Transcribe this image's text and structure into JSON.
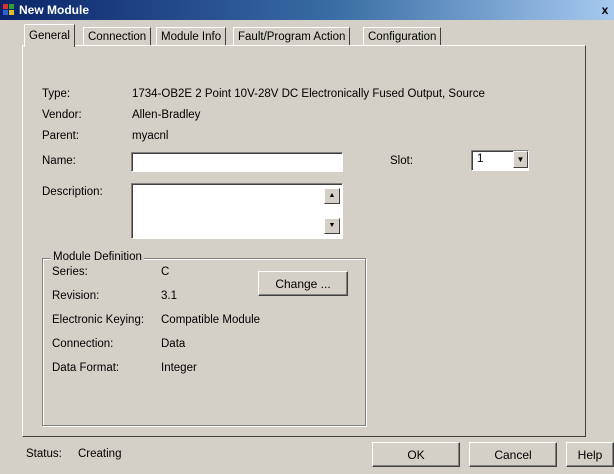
{
  "window": {
    "title": "New Module",
    "close_glyph": "x"
  },
  "tabs": [
    {
      "label": "General",
      "active": true
    },
    {
      "label": "Connection",
      "active": false
    },
    {
      "label": "Module Info",
      "active": false
    },
    {
      "label": "Fault/Program Action",
      "active": false
    },
    {
      "label": "Configuration",
      "active": false
    }
  ],
  "general": {
    "type_label": "Type:",
    "type_value": "1734-OB2E 2 Point 10V-28V DC Electronically Fused Output, Source",
    "vendor_label": "Vendor:",
    "vendor_value": "Allen-Bradley",
    "parent_label": "Parent:",
    "parent_value": "myacnl",
    "name_label": "Name:",
    "name_value": "",
    "description_label": "Description:",
    "description_value": "",
    "slot_label": "Slot:",
    "slot_value": "1"
  },
  "module_definition": {
    "title": "Module Definition",
    "change_button": "Change ...",
    "rows": [
      {
        "label": "Series:",
        "value": "C"
      },
      {
        "label": "Revision:",
        "value": "3.1"
      },
      {
        "label": "Electronic Keying:",
        "value": "Compatible Module"
      },
      {
        "label": "Connection:",
        "value": "Data"
      },
      {
        "label": "Data Format:",
        "value": "Integer"
      }
    ]
  },
  "footer": {
    "status_label": "Status:",
    "status_value": "Creating",
    "ok_button": "OK",
    "cancel_button": "Cancel",
    "help_button": "Help"
  },
  "colors": {
    "titlebar_start": "#0a246a",
    "titlebar_end": "#a6caf0",
    "dialog_face": "#d4d0c8"
  }
}
